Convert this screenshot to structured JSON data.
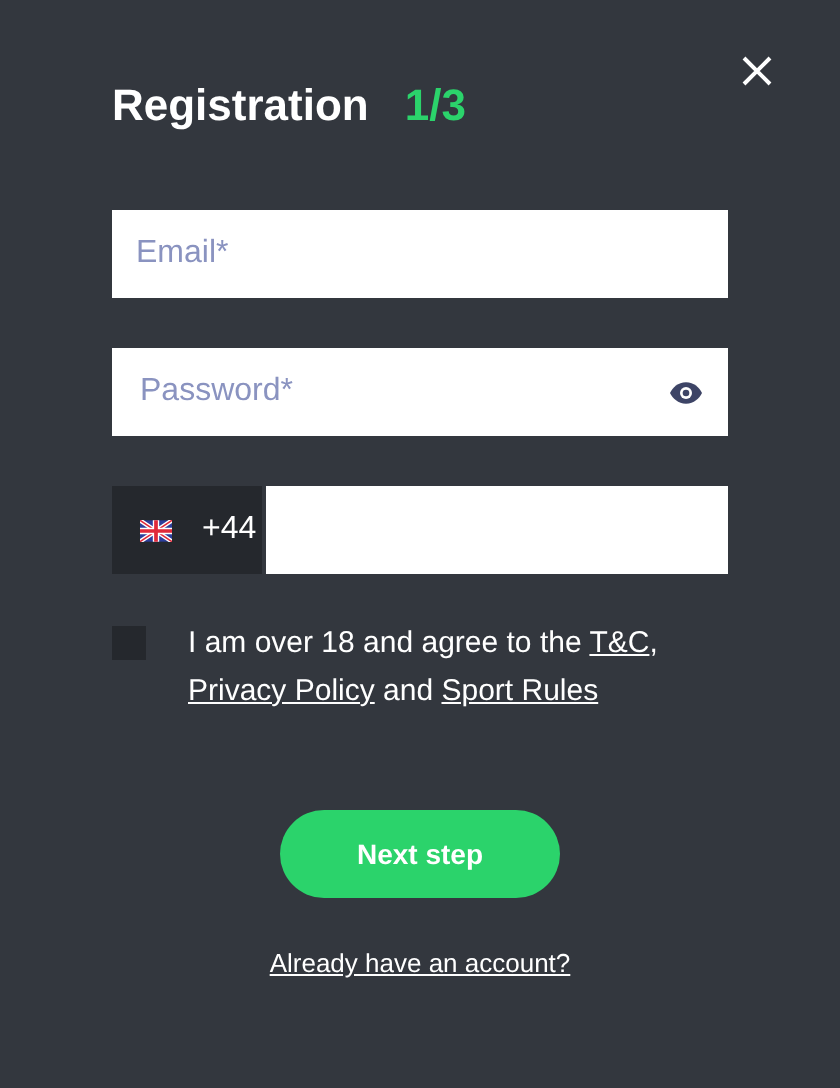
{
  "dialog": {
    "title": "Registration",
    "step": "1/3"
  },
  "fields": [
    {
      "kind": "email",
      "placeholder": "Email*"
    },
    {
      "kind": "password",
      "placeholder": "Password*"
    },
    {
      "kind": "phone",
      "prefix": "+44"
    }
  ],
  "consent": {
    "checked": false,
    "parts": [
      {
        "kind": "text",
        "text": "I am over 18 and agree to the "
      },
      {
        "kind": "link",
        "text": "T&C"
      },
      {
        "kind": "text",
        "text": ", "
      },
      {
        "kind": "link",
        "text": "Privacy Policy"
      },
      {
        "kind": "text",
        "text": " and "
      },
      {
        "kind": "link",
        "text": "Sport Rules"
      }
    ]
  },
  "primary_button": "Next step",
  "login_link": "Already have an account?"
}
